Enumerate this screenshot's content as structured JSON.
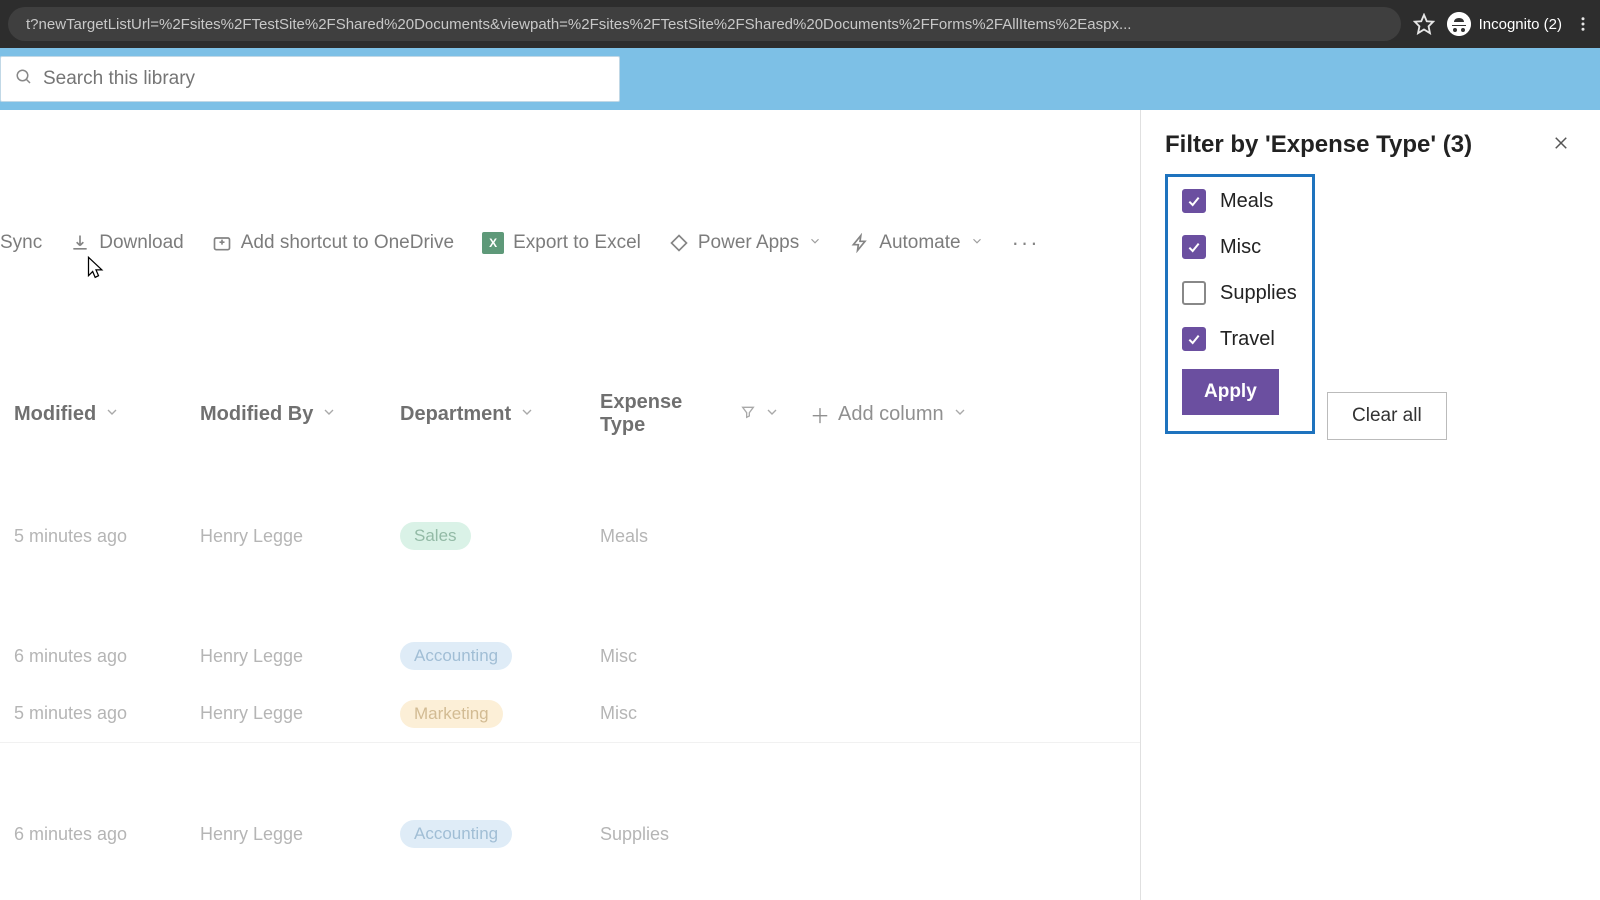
{
  "browser": {
    "url": "t?newTargetListUrl=%2Fsites%2FTestSite%2FShared%20Documents&viewpath=%2Fsites%2FTestSite%2FShared%20Documents%2FForms%2FAllItems%2Easpx...",
    "incognito_label": "Incognito (2)"
  },
  "search": {
    "placeholder": "Search this library"
  },
  "toolbar": {
    "sync": "Sync",
    "download": "Download",
    "add_shortcut": "Add shortcut to OneDrive",
    "export_excel": "Export to Excel",
    "power_apps": "Power Apps",
    "automate": "Automate"
  },
  "columns": {
    "modified": "Modified",
    "modified_by": "Modified By",
    "department": "Department",
    "expense_type": "Expense Type",
    "add_column": "Add column"
  },
  "rows": [
    {
      "modified": "5 minutes ago",
      "by": "Henry Legge",
      "dept": "Sales",
      "dept_class": "pill-sales",
      "exp": "Meals"
    },
    {
      "modified": "6 minutes ago",
      "by": "Henry Legge",
      "dept": "Accounting",
      "dept_class": "pill-acct",
      "exp": "Misc"
    },
    {
      "modified": "5 minutes ago",
      "by": "Henry Legge",
      "dept": "Marketing",
      "dept_class": "pill-mkt",
      "exp": "Misc"
    },
    {
      "modified": "6 minutes ago",
      "by": "Henry Legge",
      "dept": "Accounting",
      "dept_class": "pill-acct",
      "exp": "Supplies"
    }
  ],
  "filter_panel": {
    "title": "Filter by 'Expense Type' (3)",
    "options": [
      {
        "label": "Meals",
        "checked": true
      },
      {
        "label": "Misc",
        "checked": true
      },
      {
        "label": "Supplies",
        "checked": false
      },
      {
        "label": "Travel",
        "checked": true
      }
    ],
    "apply": "Apply",
    "clear": "Clear all"
  }
}
